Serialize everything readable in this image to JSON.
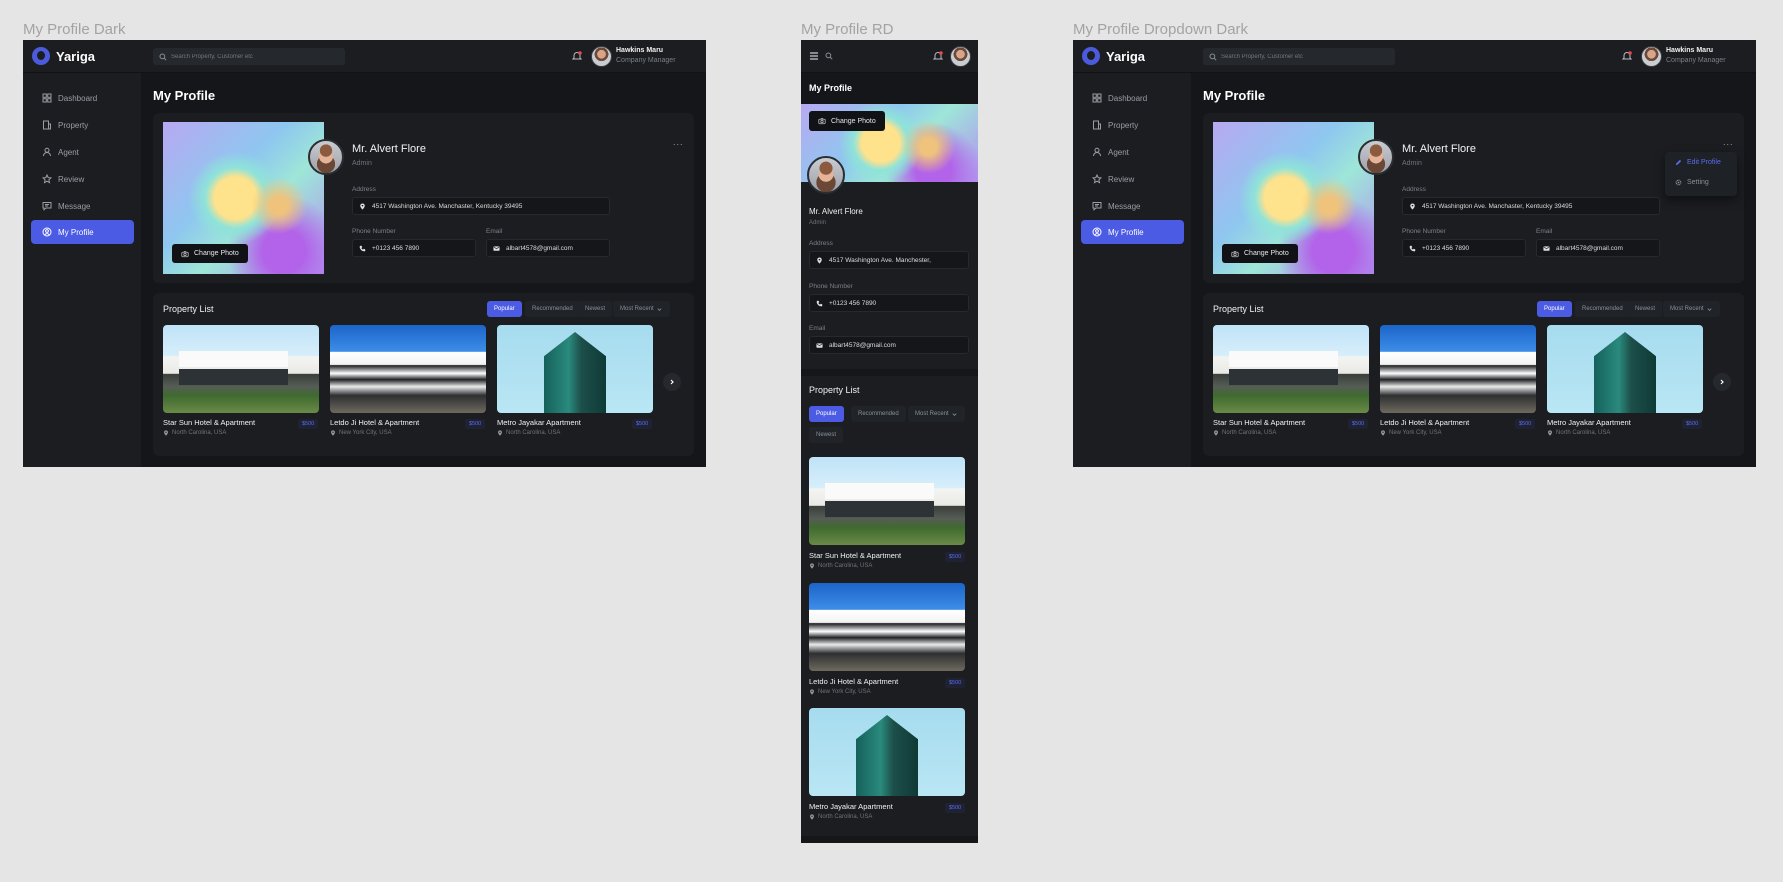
{
  "frames": {
    "dark": {
      "title": "My Profile Dark"
    },
    "rd": {
      "title": "My Profile RD"
    },
    "dropdown": {
      "title": "My Profile Dropdown Dark"
    }
  },
  "app": {
    "name": "Yariga"
  },
  "search": {
    "placeholder": "Search Property, Customer etc"
  },
  "user": {
    "name": "Hawkins Maru",
    "role": "Company Manager"
  },
  "nav": [
    {
      "label": "Dashboard",
      "icon": "dashboard-icon"
    },
    {
      "label": "Property",
      "icon": "building-icon"
    },
    {
      "label": "Agent",
      "icon": "user-icon"
    },
    {
      "label": "Review",
      "icon": "star-icon"
    },
    {
      "label": "Message",
      "icon": "message-icon"
    },
    {
      "label": "My Profile",
      "icon": "profile-icon"
    }
  ],
  "page": {
    "title": "My Profile"
  },
  "profile": {
    "change_photo": "Change Photo",
    "name": "Mr. Alvert Flore",
    "role": "Admin",
    "address_label": "Address",
    "address": "4517 Washington Ave. Manchaster, Kentucky 39495",
    "address_short": "4517 Washington Ave. Manchester,",
    "phone_label": "Phone Number",
    "phone": "+0123 456 7890",
    "email_label": "Email",
    "email": "albart4578@gmail.com",
    "more": "..."
  },
  "dropdown": {
    "edit": "Edit Profile",
    "setting": "Setting"
  },
  "property_list": {
    "title": "Property List",
    "filters": [
      "Popular",
      "Recommended",
      "Newest",
      "Most Recent"
    ],
    "items": [
      {
        "name": "Star Sun Hotel & Apartment",
        "location": "North Carolina, USA",
        "price": "$500"
      },
      {
        "name": "Letdo Ji Hotel & Apartment",
        "location": "New York City, USA",
        "price": "$500"
      },
      {
        "name": "Metro Jayakar Apartment",
        "location": "North Carolina, USA",
        "price": "$500"
      }
    ]
  },
  "colors": {
    "accent": "#4c5be3",
    "background": "#141619",
    "panel": "#1b1d21",
    "canvas": "#e5e5e5"
  }
}
